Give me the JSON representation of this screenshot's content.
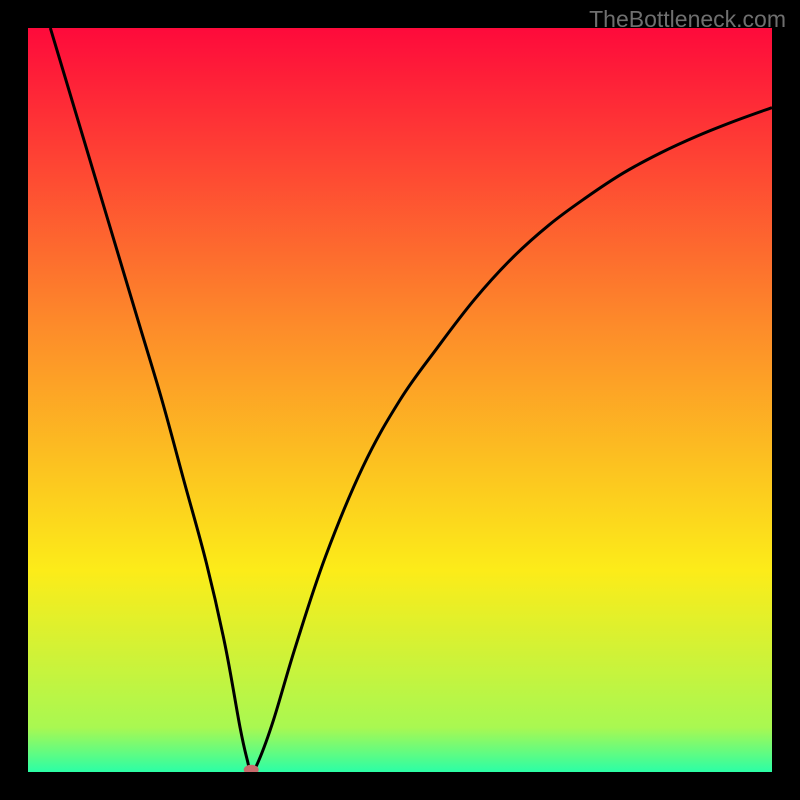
{
  "watermark": "TheBottleneck.com",
  "chart_data": {
    "type": "line",
    "title": "",
    "xlabel": "",
    "ylabel": "",
    "xlim": [
      0,
      1
    ],
    "ylim": [
      0,
      1
    ],
    "gradient_colors": {
      "top": "#fe0a3b",
      "upper_mid": "#fd8b2a",
      "mid": "#fcec19",
      "lower_mid": "#a9f851",
      "bottom": "#2bfea6"
    },
    "curve": {
      "name": "bottleneck-curve",
      "min_x": 0.3,
      "points": [
        {
          "x": 0.03,
          "y": 1.0
        },
        {
          "x": 0.06,
          "y": 0.9
        },
        {
          "x": 0.09,
          "y": 0.8
        },
        {
          "x": 0.12,
          "y": 0.7
        },
        {
          "x": 0.15,
          "y": 0.6
        },
        {
          "x": 0.18,
          "y": 0.5
        },
        {
          "x": 0.21,
          "y": 0.39
        },
        {
          "x": 0.24,
          "y": 0.28
        },
        {
          "x": 0.265,
          "y": 0.17
        },
        {
          "x": 0.285,
          "y": 0.06
        },
        {
          "x": 0.295,
          "y": 0.015
        },
        {
          "x": 0.3,
          "y": 0.0
        },
        {
          "x": 0.31,
          "y": 0.015
        },
        {
          "x": 0.33,
          "y": 0.07
        },
        {
          "x": 0.36,
          "y": 0.17
        },
        {
          "x": 0.4,
          "y": 0.29
        },
        {
          "x": 0.45,
          "y": 0.41
        },
        {
          "x": 0.5,
          "y": 0.5
        },
        {
          "x": 0.55,
          "y": 0.57
        },
        {
          "x": 0.6,
          "y": 0.635
        },
        {
          "x": 0.65,
          "y": 0.69
        },
        {
          "x": 0.7,
          "y": 0.735
        },
        {
          "x": 0.75,
          "y": 0.772
        },
        {
          "x": 0.8,
          "y": 0.805
        },
        {
          "x": 0.85,
          "y": 0.832
        },
        {
          "x": 0.9,
          "y": 0.855
        },
        {
          "x": 0.95,
          "y": 0.875
        },
        {
          "x": 1.0,
          "y": 0.893
        }
      ]
    },
    "marker": {
      "x": 0.3,
      "y": 0.003,
      "color": "#c86a6c"
    }
  }
}
